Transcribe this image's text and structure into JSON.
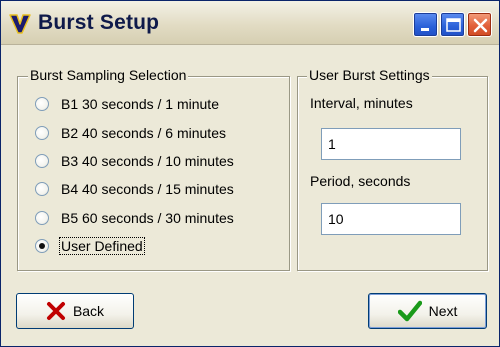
{
  "window": {
    "title": "Burst Setup",
    "icon": "v-logo-icon",
    "controls": [
      "minimize-icon",
      "maximize-icon",
      "close-icon"
    ]
  },
  "burst_group": {
    "legend": "Burst Sampling Selection",
    "options": [
      {
        "label": "B1 30 seconds / 1 minute",
        "checked": false
      },
      {
        "label": "B2 40 seconds / 6 minutes",
        "checked": false
      },
      {
        "label": "B3 40 seconds / 10 minutes",
        "checked": false
      },
      {
        "label": "B4 40 seconds / 15 minutes",
        "checked": false
      },
      {
        "label": "B5 60 seconds / 30 minutes",
        "checked": false
      },
      {
        "label": "User Defined",
        "checked": true
      }
    ]
  },
  "user_group": {
    "legend": "User Burst Settings",
    "interval_label": "Interval, minutes",
    "interval_value": "1",
    "period_label": "Period, seconds",
    "period_value": "10"
  },
  "buttons": {
    "back_label": "Back",
    "back_icon": "red-x-icon",
    "next_label": "Next",
    "next_icon": "green-checkmark-icon"
  },
  "colors": {
    "title_text": "#0f1a4a",
    "close_button": "#e2603a",
    "window_button": "#2a60d8",
    "back_icon": "#c00000",
    "next_icon": "#1a9a1a"
  }
}
